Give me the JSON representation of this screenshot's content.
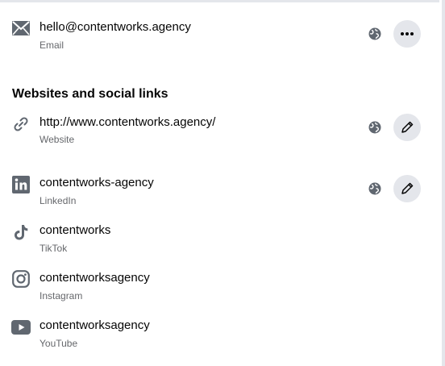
{
  "contact": {
    "email": {
      "value": "hello@contentworks.agency",
      "type": "Email",
      "icon": "mail-icon"
    }
  },
  "websites_section": {
    "title": "Websites and social links",
    "items": [
      {
        "value": "http://www.contentworks.agency/",
        "type": "Website",
        "icon": "link-icon"
      },
      {
        "value": "contentworks-agency",
        "type": "LinkedIn",
        "icon": "linkedin-icon"
      },
      {
        "value": "contentworks",
        "type": "TikTok",
        "icon": "tiktok-icon"
      },
      {
        "value": "contentworksagency",
        "type": "Instagram",
        "icon": "instagram-icon"
      },
      {
        "value": "contentworksagency",
        "type": "YouTube",
        "icon": "youtube-icon"
      }
    ]
  },
  "colors": {
    "icon": "#606770",
    "action_bg": "#e4e6eb",
    "text_primary": "#050505",
    "text_secondary": "#65676b"
  }
}
